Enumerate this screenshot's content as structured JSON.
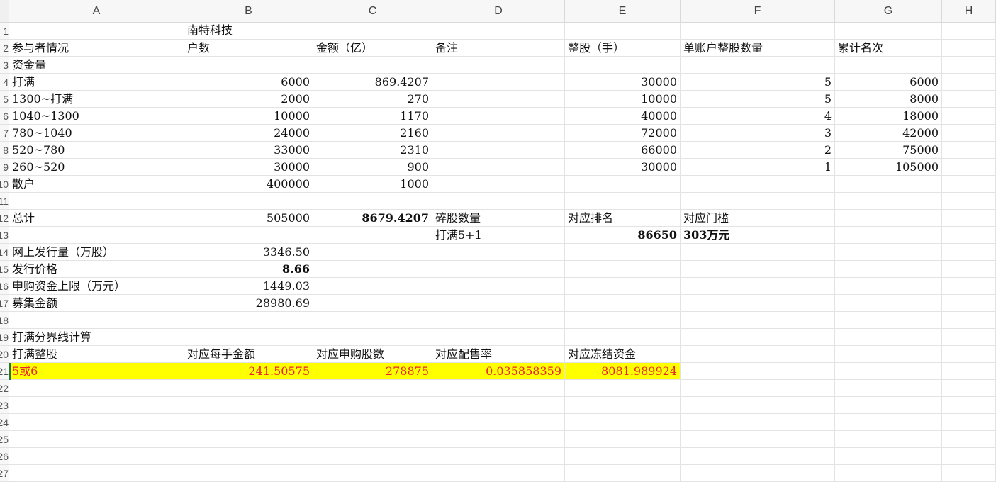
{
  "columns": [
    "A",
    "B",
    "C",
    "D",
    "E",
    "F",
    "G",
    "H"
  ],
  "row_labels": [
    "1",
    "2",
    "3",
    "4",
    "5",
    "6",
    "7",
    "8",
    "9",
    "10",
    "11",
    "12",
    "13",
    "14",
    "15",
    "16",
    "17",
    "18",
    "19",
    "20",
    "21",
    "22",
    "23",
    "24",
    "25",
    "26",
    "27"
  ],
  "cells": {
    "B1": "南特科技",
    "A2": "参与者情况",
    "B2": "户数",
    "C2": "金额（亿）",
    "D2": "备注",
    "E2": "整股（手）",
    "F2": "单账户整股数量",
    "G2": "累计名次",
    "A3": "资金量",
    "A4": "打满",
    "B4": "6000",
    "C4": "869.4207",
    "E4": "30000",
    "F4": "5",
    "G4": "6000",
    "A5": "1300~打满",
    "B5": "2000",
    "C5": "270",
    "E5": "10000",
    "F5": "5",
    "G5": "8000",
    "A6": "1040~1300",
    "B6": "10000",
    "C6": "1170",
    "E6": "40000",
    "F6": "4",
    "G6": "18000",
    "A7": "780~1040",
    "B7": "24000",
    "C7": "2160",
    "E7": "72000",
    "F7": "3",
    "G7": "42000",
    "A8": "520~780",
    "B8": "33000",
    "C8": "2310",
    "E8": "66000",
    "F8": "2",
    "G8": "75000",
    "A9": "260~520",
    "B9": "30000",
    "C9": "900",
    "E9": "30000",
    "F9": "1",
    "G9": "105000",
    "A10": "散户",
    "B10": "400000",
    "C10": "1000",
    "A12": "总计",
    "B12": "505000",
    "C12": "8679.4207",
    "D12": "碎股数量",
    "E12": "对应排名",
    "F12": "对应门槛",
    "D13": "打满5+1",
    "E13": "86650",
    "F13": "303万元",
    "A14": "网上发行量（万股）",
    "B14": "3346.50",
    "A15": "发行价格",
    "B15": "8.66",
    "A16": "申购资金上限（万元）",
    "B16": "1449.03",
    "A17": "募集金额",
    "B17": "28980.69",
    "A19": "打满分界线计算",
    "A20": "打满整股",
    "B20": "对应每手金额",
    "C20": "对应申购股数",
    "D20": "对应配售率",
    "E20": "对应冻结资金",
    "A21": "5或6",
    "B21": "241.50575",
    "C21": "278875",
    "D21": "0.035858359",
    "E21": "8081.989924"
  },
  "colors": {
    "highlight_fill": "#ffff00",
    "highlight_text": "#e8242b",
    "header_bg": "#f7f7f7",
    "grid": "#e3e3e3"
  }
}
